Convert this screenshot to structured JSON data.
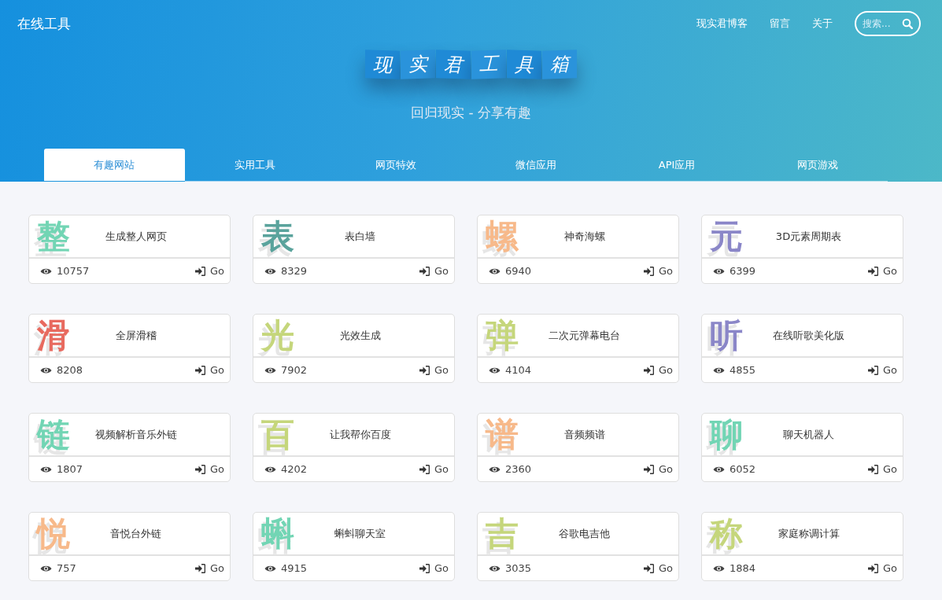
{
  "brand": "在线工具",
  "nav": [
    "现实君博客",
    "留言",
    "关于"
  ],
  "search": {
    "placeholder": "搜索..."
  },
  "title_tiles": [
    "现",
    "实",
    "君",
    "工",
    "具",
    "箱"
  ],
  "subtitle": "回归现实 - 分享有趣",
  "tabs": [
    {
      "label": "有趣网站",
      "selected": true
    },
    {
      "label": "实用工具",
      "selected": false
    },
    {
      "label": "网页特效",
      "selected": false
    },
    {
      "label": "微信应用",
      "selected": false
    },
    {
      "label": "API应用",
      "selected": false
    },
    {
      "label": "网页游戏",
      "selected": false
    }
  ],
  "cards": [
    {
      "glyph": "整",
      "color": "#72d5b4",
      "title": "生成整人网页",
      "views": "10757",
      "go": "Go"
    },
    {
      "glyph": "表",
      "color": "#5aa39c",
      "title": "表白墙",
      "views": "8329",
      "go": "Go"
    },
    {
      "glyph": "螺",
      "color": "#f7b98a",
      "title": "神奇海螺",
      "views": "6940",
      "go": "Go"
    },
    {
      "glyph": "元",
      "color": "#8a86c8",
      "title": "3D元素周期表",
      "views": "6399",
      "go": "Go"
    },
    {
      "glyph": "滑",
      "color": "#e86a5f",
      "title": "全屏滑稽",
      "views": "8208",
      "go": "Go"
    },
    {
      "glyph": "光",
      "color": "#c5d67b",
      "title": "光效生成",
      "views": "7902",
      "go": "Go"
    },
    {
      "glyph": "弹",
      "color": "#c5d67b",
      "title": "二次元弹幕电台",
      "views": "4104",
      "go": "Go"
    },
    {
      "glyph": "听",
      "color": "#8a86c8",
      "title": "在线听歌美化版",
      "views": "4855",
      "go": "Go"
    },
    {
      "glyph": "链",
      "color": "#72d5b4",
      "title": "视频解析音乐外链",
      "views": "1807",
      "go": "Go"
    },
    {
      "glyph": "百",
      "color": "#c5d67b",
      "title": "让我帮你百度",
      "views": "4202",
      "go": "Go"
    },
    {
      "glyph": "谱",
      "color": "#f7b98a",
      "title": "音频频谱",
      "views": "2360",
      "go": "Go"
    },
    {
      "glyph": "聊",
      "color": "#72d5b4",
      "title": "聊天机器人",
      "views": "6052",
      "go": "Go"
    },
    {
      "glyph": "悦",
      "color": "#f7b98a",
      "title": "音悦台外链",
      "views": "757",
      "go": "Go"
    },
    {
      "glyph": "蝌",
      "color": "#72d5b4",
      "title": "蝌蚪聊天室",
      "views": "4915",
      "go": "Go"
    },
    {
      "glyph": "吉",
      "color": "#c5d67b",
      "title": "谷歌电吉他",
      "views": "3035",
      "go": "Go"
    },
    {
      "glyph": "称",
      "color": "#c5d67b",
      "title": "家庭称调计算",
      "views": "1884",
      "go": "Go"
    }
  ]
}
